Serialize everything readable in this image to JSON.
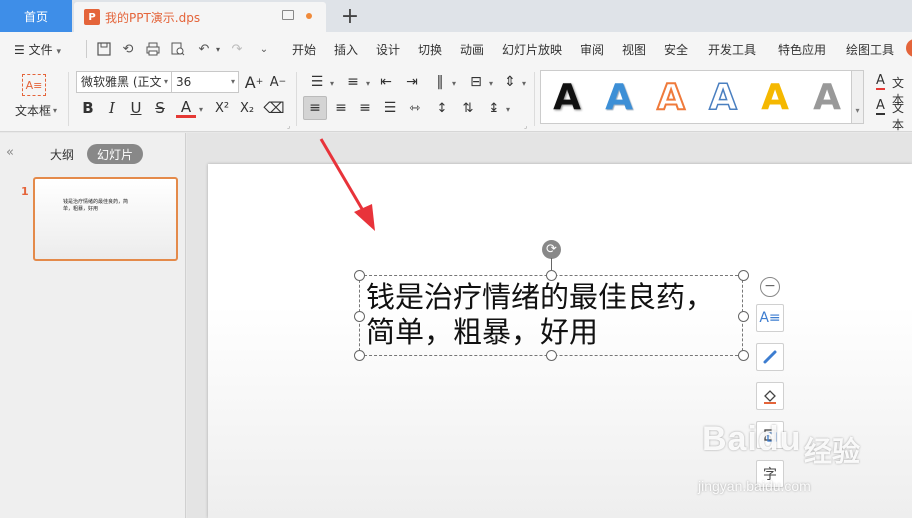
{
  "titlebar": {
    "home_tab": "首页",
    "doc_tab": {
      "icon_letter": "P",
      "name": "我的PPT演示.dps"
    },
    "new_tab": "+"
  },
  "menubar": {
    "file_label": "文件",
    "menus": [
      "开始",
      "插入",
      "设计",
      "切换",
      "动画",
      "幻灯片放映",
      "审阅",
      "视图",
      "安全",
      "开发工具",
      "特色应用",
      "绘图工具"
    ]
  },
  "ribbon": {
    "textbox_label": "文本框",
    "font_name": "微软雅黑 (正文",
    "font_size": "36",
    "grow_font": "A",
    "shrink_font": "A",
    "bold": "B",
    "italic": "I",
    "underline": "U",
    "strike": "S",
    "font_color": "A",
    "superscript": "X²",
    "subscript": "X₂",
    "wordart_letter": "A",
    "right_text_1": "文本",
    "right_text_2": "文本"
  },
  "colors": {
    "accent_blue": "#3e8ee8",
    "doc_orange": "#e4643a",
    "thumb_border": "#e48a4a",
    "arrow_red": "#e8333a"
  },
  "left_panel": {
    "collapse": "«",
    "outline_tab": "大纲",
    "slides_tab": "幻灯片",
    "slide_number": "1",
    "thumb_text": "钱是治疗情绪的最佳良药，简单，粗暴，好用"
  },
  "slide": {
    "text_line1": "钱是治疗情绪的最佳良药，",
    "text_line2": "简单，粗暴，好用"
  },
  "float_toolbar": {
    "collapse": "−",
    "icons": [
      "text-select-icon",
      "brush-icon",
      "fill-icon",
      "crop-icon",
      "more-text-icon"
    ]
  },
  "watermark": {
    "logo": "Baidu",
    "cn": "经验",
    "url": "jingyan.baidu.com"
  }
}
